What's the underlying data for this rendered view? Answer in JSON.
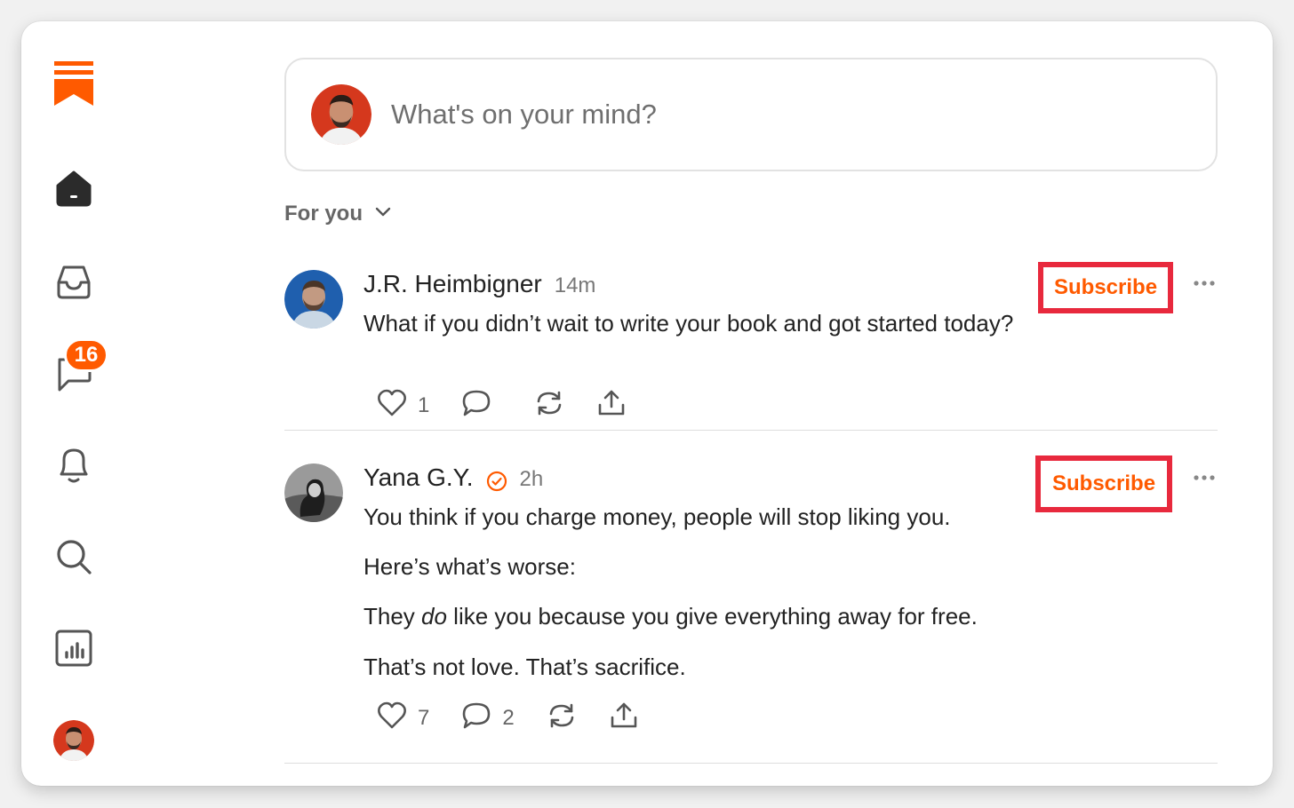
{
  "colors": {
    "accent": "#ff5a00",
    "highlight": "#e8293d",
    "badge": "#ff5a00"
  },
  "sidebar": {
    "logo": "substack-logo-icon",
    "items": [
      {
        "name": "home",
        "icon": "home-icon"
      },
      {
        "name": "inbox",
        "icon": "inbox-icon"
      },
      {
        "name": "chat",
        "icon": "chat-icon",
        "badge": "16"
      },
      {
        "name": "notifications",
        "icon": "bell-icon"
      },
      {
        "name": "search",
        "icon": "search-icon"
      },
      {
        "name": "stats",
        "icon": "bar-chart-icon"
      },
      {
        "name": "profile",
        "icon": "avatar"
      }
    ]
  },
  "composer": {
    "placeholder": "What's on your mind?"
  },
  "feed": {
    "filter_label": "For you"
  },
  "posts": [
    {
      "author": "J.R. Heimbigner",
      "time": "14m",
      "verified": false,
      "subscribe_label": "Subscribe",
      "paragraphs": [
        "What if you didn’t wait to write your book and got started today?"
      ],
      "likes": "1",
      "comments": ""
    },
    {
      "author": "Yana G.Y.",
      "time": "2h",
      "verified": true,
      "subscribe_label": "Subscribe",
      "paragraphs": [
        "You think if you charge money, people will stop liking you.",
        "Here’s what’s worse:",
        "They ",
        "do",
        " like you because you give everything away for free.",
        "That’s not love. That’s sacrifice."
      ],
      "likes": "7",
      "comments": "2"
    }
  ]
}
